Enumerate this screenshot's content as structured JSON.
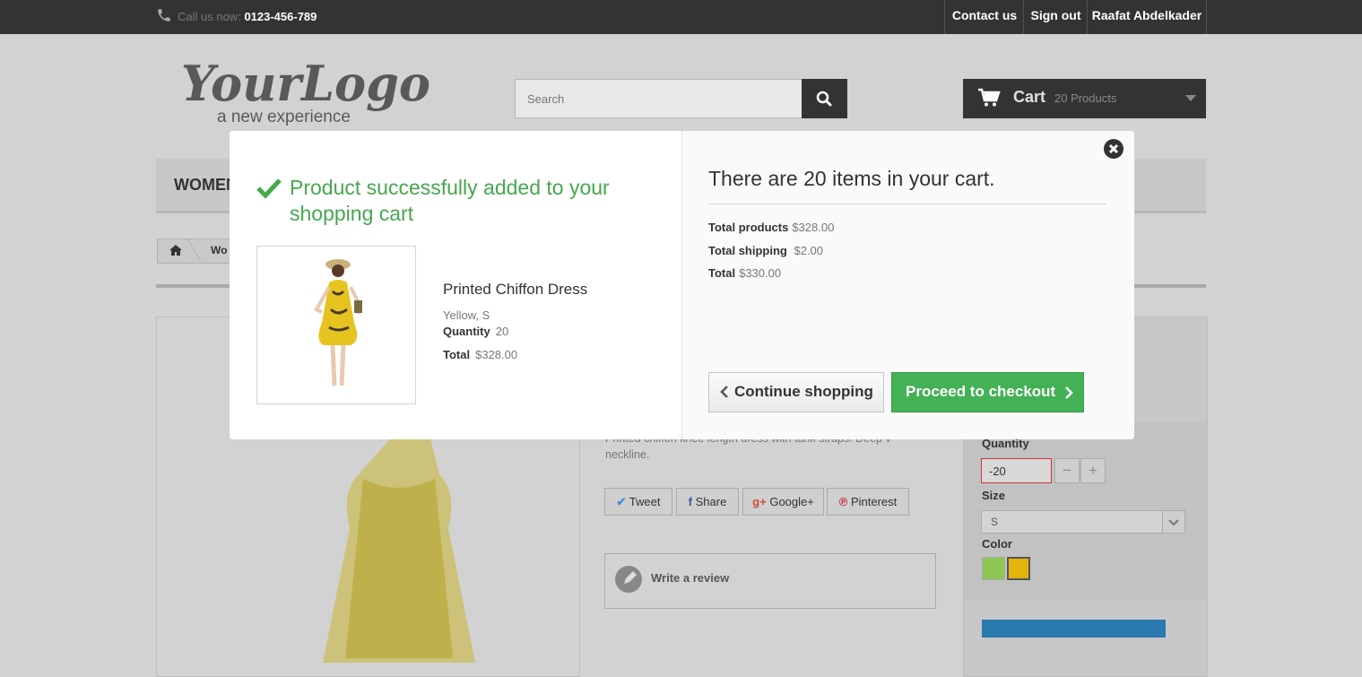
{
  "topbar": {
    "call_label": "Call us now:",
    "phone": "0123-456-789",
    "links": [
      "Contact us",
      "Sign out",
      "Raafat Abdelkader"
    ]
  },
  "header": {
    "logo_main": "YourLogo",
    "logo_tagline": "a new experience",
    "search_placeholder": "Search",
    "cart_label": "Cart",
    "cart_count": "20 Products"
  },
  "nav": {
    "first_item": "WOMEN"
  },
  "breadcrumb": {
    "crumb": "Wo"
  },
  "page": {
    "description": "Printed chiffon knee length dress with tank straps. Deep v-neckline.",
    "social": [
      "Tweet",
      "Share",
      "Google+",
      "Pinterest"
    ],
    "review": "Write a review",
    "quantity_label": "Quantity",
    "quantity_value": "-20",
    "size_label": "Size",
    "size_value": "S",
    "color_label": "Color",
    "colors": [
      "#8dc655",
      "#e4b30c"
    ]
  },
  "modal": {
    "success_message": "Product successfully added to your shopping cart",
    "product_name": "Printed Chiffon Dress",
    "product_attributes": "Yellow, S",
    "quantity_label": "Quantity",
    "quantity_value": "20",
    "total_label": "Total",
    "total_value": "$328.00",
    "cart_summary": "There are 20 items in your cart.",
    "total_products_label": "Total products",
    "total_products_value": "$328.00",
    "total_shipping_label": "Total shipping",
    "total_shipping_value": "$2.00",
    "grand_total_label": "Total",
    "grand_total_value": "$330.00",
    "continue_label": "Continue shopping",
    "checkout_label": "Proceed to checkout"
  },
  "colors": {
    "success_green": "#46a74e",
    "checkout_green": "#43b155",
    "dark": "#333333"
  }
}
